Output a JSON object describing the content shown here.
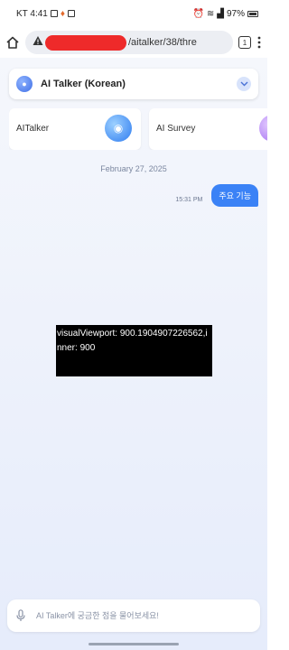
{
  "status_bar": {
    "carrier_time": "KT 4:41",
    "battery": "97%"
  },
  "browser": {
    "url_suffix": "/aitalker/38/thre",
    "tab_count": "1"
  },
  "bot_selector": {
    "name": "AI Talker (Korean)"
  },
  "cards": [
    {
      "label": "AITalker"
    },
    {
      "label": "AI Survey"
    }
  ],
  "chat": {
    "date": "February 27, 2025",
    "messages": [
      {
        "time": "15:31 PM",
        "text": "주요 기능",
        "sender": "user"
      }
    ]
  },
  "debug": {
    "text": "visualViewport: 900.1904907226562,inner: 900"
  },
  "input": {
    "placeholder": "AI Talker에 궁금한 점을 물어보세요!"
  },
  "colors": {
    "accent": "#3b82f6",
    "redaction": "#ee2a2a"
  }
}
